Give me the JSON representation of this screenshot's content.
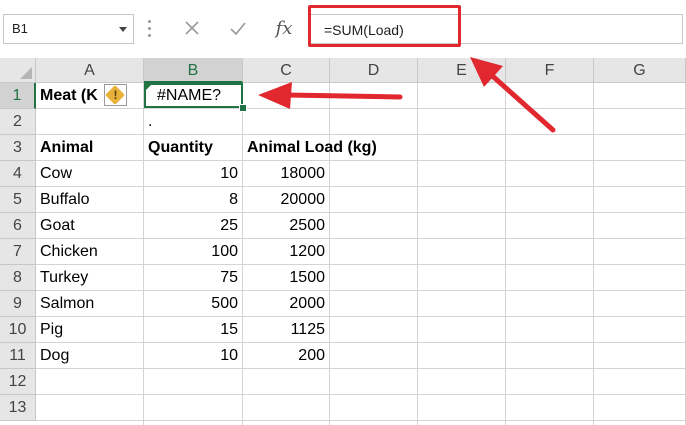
{
  "name_box": {
    "value": "B1"
  },
  "formula_bar": {
    "cancel_icon": "x-icon",
    "enter_icon": "check-icon",
    "function_label": "fx",
    "formula": "=SUM(Load)"
  },
  "columns": [
    "A",
    "B",
    "C",
    "D",
    "E",
    "F",
    "G"
  ],
  "rows": [
    "1",
    "2",
    "3",
    "4",
    "5",
    "6",
    "7",
    "8",
    "9",
    "10",
    "11",
    "12",
    "13"
  ],
  "cells": {
    "a1": "Meat (K",
    "b1": "#NAME?",
    "b2": ".",
    "headers": {
      "animal": "Animal",
      "quantity": "Quantity",
      "load": "Animal Load (kg)"
    },
    "data": [
      {
        "animal": "Cow",
        "quantity": "10",
        "load": "18000"
      },
      {
        "animal": "Buffalo",
        "quantity": "8",
        "load": "20000"
      },
      {
        "animal": "Goat",
        "quantity": "25",
        "load": "2500"
      },
      {
        "animal": "Chicken",
        "quantity": "100",
        "load": "1200"
      },
      {
        "animal": "Turkey",
        "quantity": "75",
        "load": "1500"
      },
      {
        "animal": "Salmon",
        "quantity": "500",
        "load": "2000"
      },
      {
        "animal": "Pig",
        "quantity": "15",
        "load": "1125"
      },
      {
        "animal": "Dog",
        "quantity": "10",
        "load": "200"
      }
    ]
  },
  "error_badge": {
    "icon": "warning-icon",
    "symbol": "!"
  },
  "colors": {
    "selection": "#217346",
    "annotation": "#e0282e",
    "header_bg": "#e6e6e6",
    "gridline": "#d4d4d4"
  }
}
